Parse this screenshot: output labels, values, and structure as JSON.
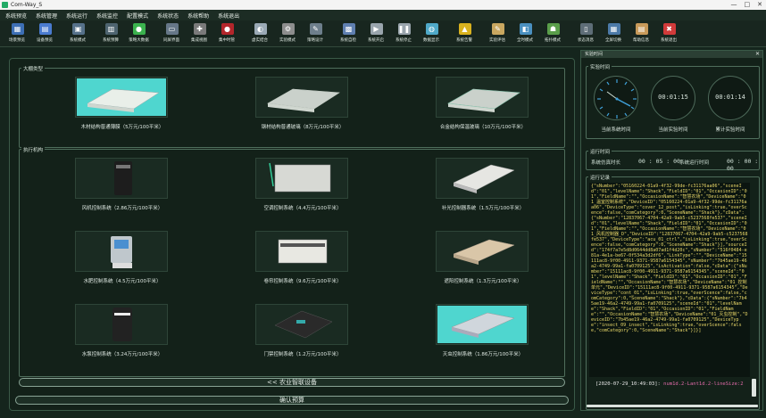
{
  "window": {
    "title": "Com-Way_S",
    "controls": [
      "—",
      "□",
      "✕"
    ]
  },
  "menu": [
    "系统预览",
    "系统管理",
    "系统运行",
    "系统监控",
    "配置模式",
    "系统状态",
    "系统帮助",
    "系统退出"
  ],
  "toolbar": [
    {
      "label": "场景预览",
      "icon": "scene-icon",
      "color": "#3d6fb5",
      "glyph": "▦"
    },
    {
      "label": "设备预览",
      "icon": "device-icon",
      "color": "#4a7bd0",
      "glyph": "▤"
    },
    {
      "label": "系统模式",
      "icon": "mode-icon",
      "color": "#56718a",
      "glyph": "▣"
    },
    {
      "label": "系统预算",
      "icon": "budget-icon",
      "color": "#4e6470",
      "glyph": "▥"
    },
    {
      "label": "策略大数据",
      "icon": "data-icon",
      "color": "#3bb24e",
      "glyph": "●"
    },
    {
      "label": "同屏界面",
      "icon": "screen-icon",
      "color": "#667788",
      "glyph": "▭"
    },
    {
      "label": "集成视图",
      "icon": "view-icon",
      "color": "#7a7a7a",
      "glyph": "✚"
    },
    {
      "label": "集中时管",
      "icon": "time-icon",
      "color": "#b3262b",
      "glyph": "●"
    },
    {
      "label": "虚实结合",
      "icon": "virtual-icon",
      "color": "#9aa9b5",
      "glyph": "◐"
    },
    {
      "label": "实验模式",
      "icon": "lab-icon",
      "color": "#8d8d8d",
      "glyph": "⚙"
    },
    {
      "label": "策略设计",
      "icon": "design-icon",
      "color": "#6e7f8c",
      "glyph": "✎"
    },
    {
      "label": "系统自检",
      "icon": "selfcheck-icon",
      "color": "#5f7fb0",
      "glyph": "▩"
    },
    {
      "label": "系统开启",
      "icon": "start-icon",
      "color": "#9aa5ad",
      "glyph": "▶"
    },
    {
      "label": "系统停止",
      "icon": "stop-icon",
      "color": "#9aa5ad",
      "glyph": "❚❚"
    },
    {
      "label": "数据显示",
      "icon": "display-icon",
      "color": "#4fa9c8",
      "glyph": "◍"
    },
    {
      "label": "系统告警",
      "icon": "alarm-icon",
      "color": "#d9b21f",
      "glyph": "▲"
    },
    {
      "label": "实验评估",
      "icon": "evaluate-icon",
      "color": "#c9a760",
      "glyph": "✎"
    },
    {
      "label": "全时模式",
      "icon": "fulltime-icon",
      "color": "#4a90c0",
      "glyph": "◧"
    },
    {
      "label": "拓扑模式",
      "icon": "topology-icon",
      "color": "#5a9e4a",
      "glyph": "☗"
    },
    {
      "label": "状态消息",
      "icon": "message-icon",
      "color": "#5e6d77",
      "glyph": "▯"
    },
    {
      "label": "全屏切换",
      "icon": "fullscreen-icon",
      "color": "#4c7aa8",
      "glyph": "▦"
    },
    {
      "label": "帮助信息",
      "icon": "help-icon",
      "color": "#c89a5a",
      "glyph": "▤"
    },
    {
      "label": "系统退出",
      "icon": "exit-icon",
      "color": "#d13a3a",
      "glyph": "✖"
    }
  ],
  "greenhouse": {
    "title": "大棚类型",
    "items": [
      {
        "label": "木材结构普通薄膜（5万元/100平米）",
        "color": "#4fd6cf"
      },
      {
        "label": "钢材结构普通玻璃（8万元/100平米）",
        "color": "#c8cfc6"
      },
      {
        "label": "合金结构保温玻璃（10万元/100平米）",
        "color": "#8dc7b0"
      }
    ]
  },
  "actuators": {
    "title": "执行机构",
    "items": [
      {
        "label": "风机控制系统（2.86万元/100平米）",
        "color": "#1d1d1d"
      },
      {
        "label": "空调控制系统（4.4万元/100平米）",
        "color": "#d7d9d4"
      },
      {
        "label": "补光控制器系统（1.5万元/100平米）",
        "color": "#e6e6e2"
      },
      {
        "label": "水肥控制系统（4.5万元/100平米）",
        "color": "#bfc7cc"
      },
      {
        "label": "卷帘控制系统（9.6万元/100平米）",
        "color": "#e8e8e2"
      },
      {
        "label": "遮阳控制系统（1.3万元/100平米）",
        "color": "#d9c6a8"
      },
      {
        "label": "水泵控制系统（3.24万元/100平米）",
        "color": "#222222"
      },
      {
        "label": "门禁控制系统（1.2万元/100平米）",
        "color": "#2a2a2a"
      },
      {
        "label": "灭虫控制系统（1.86万元/100平米）",
        "color": "#d0d6dc"
      }
    ]
  },
  "nav": {
    "back_label": "<< 农业智联设备",
    "confirm_label": "确认预算"
  },
  "side": {
    "header": "实验时间",
    "exp_time": {
      "title": "实验时间",
      "current_label": "当前系统时间",
      "current_exp_label": "当前实验时间",
      "current_exp_value": "00:01:15",
      "total_label": "累计实验时间",
      "total_value": "00:01:14"
    },
    "run_time": {
      "title": "运行时间",
      "sim_label": "系统仿真时长",
      "sim_value": "00 : 05 : 00",
      "run_label": "系统运行时间",
      "run_value": "00 : 00 : 00"
    },
    "log": {
      "title": "运行记录",
      "text": "{\"sNumber\":\"05160224-01a9-4f32-99de-fc31176aa06\",\"sceneId\":\"01\",\"levelName\":\"Shack\",\"FieldID\":\"01\",\"OccasionID\":\"01\",\"FieldName\":\"\",\"OccasionName\":\"智慧农场\",\"DeviceName\":\"01_温室控制系统\",\"DeviceID\":\"05160224-01a9-4f32-99de-fc31176aa06\",\"DeviceType\":\"cover_12_post\",\"isLinking\":true,\"overScence\":false,\"comCategory\":0,\"SceneName\":\"Shack\"},\"cData\":{\"sNumber\":\"12837067-4704-42a9-9ab5-c5237568fe537\",\"sceneId\":\"01\",\"levelName\":\"Shack\",\"FieldID\":\"01\",\"OccasionID\":\"01\",\"FieldName\":\"\",\"OccasionName\":\"智慧农场\",\"DeviceName\":\"01_风机控制器_D\",\"DeviceID\":\"12837067-4704-42a9-9ab5-c5237568fe537\",\"DeviceType\":\"acu_01_ctrl\",\"isLinking\":true,\"overScence\":false,\"comCategory\":0,\"SceneName\":\"Shack\"}],\"sourceId\":\"174f7a7e5d8d0644dd8a07ad1f4d20c\",\"sNumber\":\"516f0484-e81a-4e1a-be67-0f534a3d2df6\",\"LinkType\":\"\",\"DeviceName\":\"15111ac8-9f00-4911-9371-9587a6154345\",\"sNumber\":\"7b45ae19-46a2-4749-99a1-fa0709125\",\"isActivation\":false,\"cData\":{\"sNumber\":\"15111ac8-9f00-4911-9371-9587a6154345\",\"sceneId\":\"01\",\"levelName\":\"Shack\",\"FieldID\":\"01\",\"OccasionID\":\"01\",\"FieldName\":\"\",\"OccasionName\":\"智慧农场\",\"DeviceName\":\"01_控制单元\",\"DeviceID\":\"15111ac8-9f00-4911-9371-9587a6154345\",\"DeviceType\":\"cont_01\",\"isLinking\":true,\"overScence\":false,\"comCategory\":0,\"SceneName\":\"Shack\"},\"cData\":{\"sNumber\":\"7b45ae19-46a2-4749-99a1-fa0709125\",\"sceneId\":\"01\",\"levelName\":\"Shack\",\"FieldID\":\"01\",\"OccasionID\":\"01\",\"FieldName\":\"\",\"OccasionName\":\"智慧农场\",\"DeviceName\":\"01_灭虫控制\",\"DeviceID\":\"7b45ae19-46a2-4749-99a1-fa0709125\",\"DeviceType\":\"insect_09_insect\",\"isLinking\":true,\"overScence\":false,\"comCategory\":0,\"SceneName\":\"Shack\"}]}]",
      "stamp": "[2020-07-29_10:49:03]:",
      "tag": "num1d.2-Lant1d.2-lineSize:2"
    }
  }
}
